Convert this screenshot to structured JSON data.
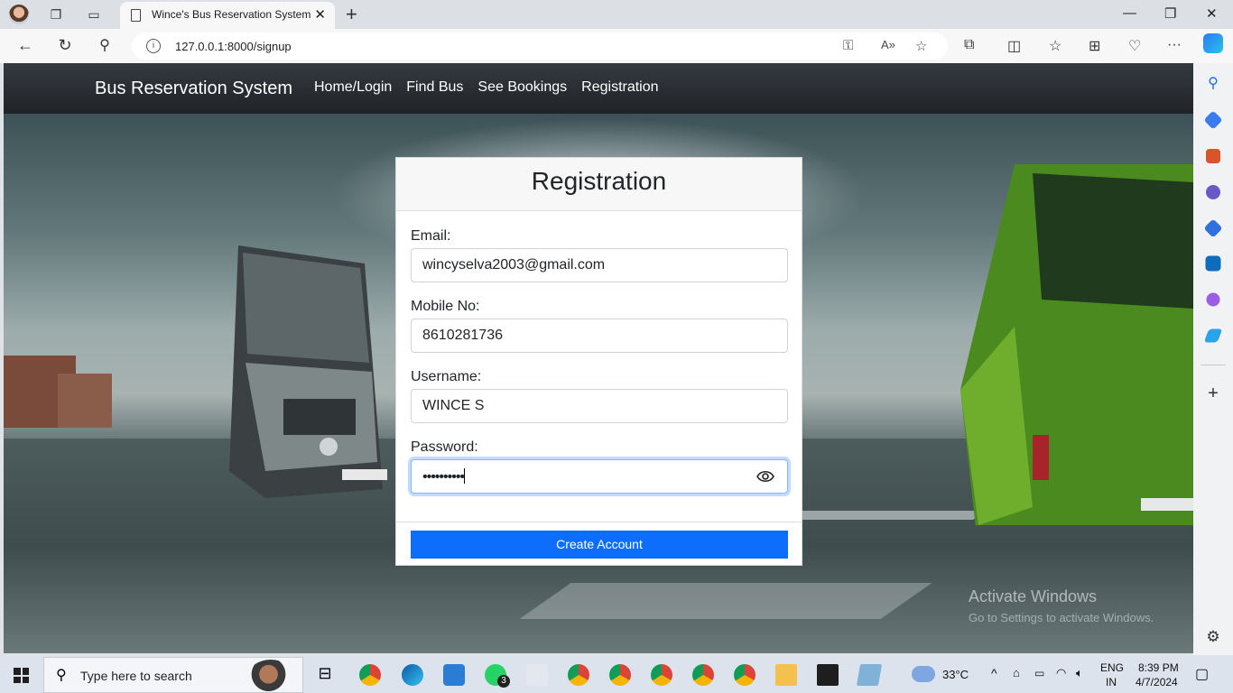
{
  "browser": {
    "tab_title": "Wince's Bus Reservation System",
    "url": "127.0.0.1:8000/signup"
  },
  "navbar": {
    "brand": "Bus Reservation System",
    "links": [
      "Home/Login",
      "Find Bus",
      "See Bookings",
      "Registration"
    ]
  },
  "form": {
    "title": "Registration",
    "email_label": "Email:",
    "email_value": "wincyselva2003@gmail.com",
    "mobile_label": "Mobile No:",
    "mobile_value": "8610281736",
    "username_label": "Username:",
    "username_value": "WINCE S",
    "password_label": "Password:",
    "password_value": "••••••••••",
    "submit_label": "Create Account"
  },
  "watermark": {
    "line1": "Activate Windows",
    "line2": "Go to Settings to activate Windows."
  },
  "taskbar": {
    "search_placeholder": "Type here to search",
    "whatsapp_badge": "3",
    "weather": "33°C",
    "lang_top": "ENG",
    "lang_bottom": "IN",
    "time": "8:39 PM",
    "date": "4/7/2024"
  },
  "colors": {
    "primary_button": "#0d6efd",
    "navbar": "#212529"
  }
}
